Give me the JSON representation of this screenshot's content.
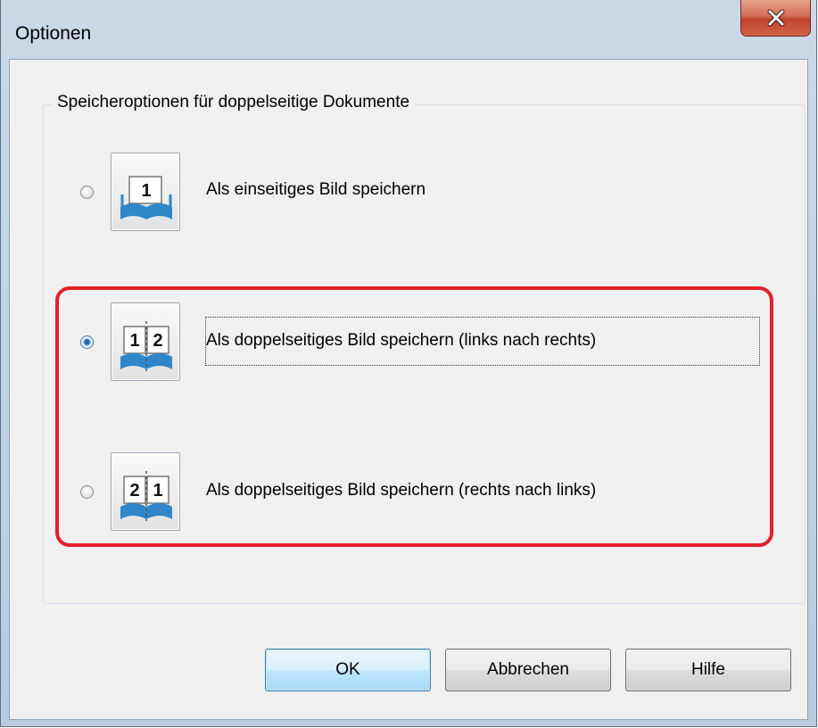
{
  "window": {
    "title": "Optionen",
    "close_glyph": "X"
  },
  "group": {
    "title": "Speicheroptionen für doppelseitige Dokumente"
  },
  "options": [
    {
      "label": "Als einseitiges Bild speichern",
      "icon": "single-page-book-icon",
      "pages": [
        "1"
      ],
      "selected": false
    },
    {
      "label": "Als doppelseitiges Bild speichern (links nach rechts)",
      "icon": "double-page-left-to-right-icon",
      "pages": [
        "1",
        "2"
      ],
      "selected": true
    },
    {
      "label": "Als doppelseitiges Bild speichern (rechts nach links)",
      "icon": "double-page-right-to-left-icon",
      "pages": [
        "2",
        "1"
      ],
      "selected": false
    }
  ],
  "buttons": {
    "ok": "OK",
    "cancel": "Abbrechen",
    "help": "Hilfe"
  },
  "colors": {
    "highlight": "#e2202c",
    "book_blue": "#2f86c9"
  }
}
